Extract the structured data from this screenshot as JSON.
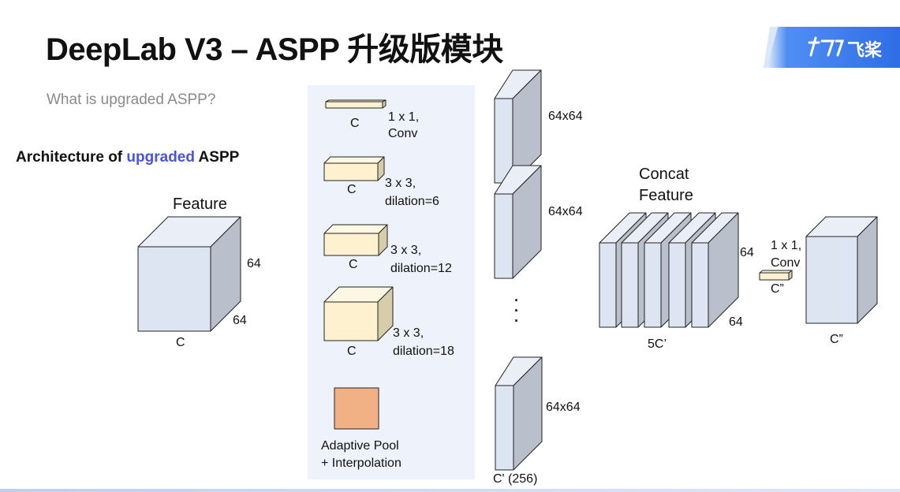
{
  "slide": {
    "title": "DeepLab V3 – ASPP 升级版模块",
    "subtitle": "What is upgraded ASPP?",
    "architecture_prefix": "Architecture of ",
    "architecture_highlight": "upgraded",
    "architecture_suffix": " ASPP",
    "logo_text": "飞桨"
  },
  "feature": {
    "title": "Feature",
    "depth_label": "64",
    "height_label": "64",
    "width_label": "C"
  },
  "branches": [
    {
      "label_line1": "1 x 1,",
      "label_line2": "Conv",
      "width_label": "C"
    },
    {
      "label_line1": "3 x 3,",
      "label_line2": "dilation=6",
      "width_label": "C"
    },
    {
      "label_line1": "3 x 3,",
      "label_line2": "dilation=12",
      "width_label": "C"
    },
    {
      "label_line1": "3 x 3,",
      "label_line2": "dilation=18",
      "width_label": "C"
    },
    {
      "label_line1": "Adaptive Pool",
      "label_line2": "+ Interpolation"
    }
  ],
  "outputs": [
    {
      "size_label": "64x64"
    },
    {
      "size_label": "64x64"
    },
    {
      "size_label": "64x64"
    }
  ],
  "ellipsis": "·\n·\n·",
  "output_channel_label": "C' (256)",
  "concat": {
    "title_line1": "Concat",
    "title_line2": "Feature",
    "height_label": "64",
    "depth_label": "64",
    "width_label": "5C’"
  },
  "final_conv": {
    "label_line1": "1 x 1,",
    "label_line2": "Conv",
    "channel_label": "C”"
  },
  "final_feature": {
    "width_label": "C”"
  },
  "colors": {
    "cube_front": "#dde5f3",
    "cube_side": "#b9bfcb",
    "cube_top": "#e9eef7",
    "conv_front": "#fdf1cf",
    "conv_side": "#d8cdaa",
    "conv_top": "#fef7e3",
    "pool_fill": "#f2b185",
    "highlight": "#4a55d6"
  }
}
